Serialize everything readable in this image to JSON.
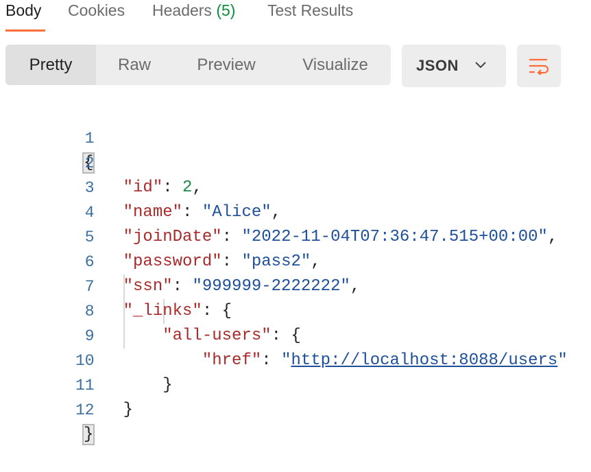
{
  "tabs": [
    {
      "label": "Body"
    },
    {
      "label": "Cookies"
    },
    {
      "label": "Headers",
      "count": "(5)"
    },
    {
      "label": "Test Results"
    }
  ],
  "toolbar": {
    "view_modes": [
      "Pretty",
      "Raw",
      "Preview",
      "Visualize"
    ],
    "active_view": "Pretty",
    "format": "JSON",
    "wrap_icon": "wrap-lines-icon"
  },
  "code": {
    "line_numbers": [
      "1",
      "2",
      "3",
      "4",
      "5",
      "6",
      "7",
      "8",
      "9",
      "10",
      "11",
      "12"
    ],
    "open_brace": "{",
    "close_brace": "}",
    "l2_key": "\"id\"",
    "l2_val": "2",
    "l3_key": "\"name\"",
    "l3_val": "\"Alice\"",
    "l4_key": "\"joinDate\"",
    "l4_val": "\"2022-11-04T07:36:47.515+00:00\"",
    "l5_key": "\"password\"",
    "l5_val": "\"pass2\"",
    "l6_key": "\"ssn\"",
    "l6_val": "\"999999-2222222\"",
    "l7_key": "\"_links\"",
    "l8_key": "\"all-users\"",
    "l9_key": "\"href\"",
    "l9_q": "\"",
    "l9_url": "http://localhost:8088/users"
  },
  "colors": {
    "accent": "#ff6c37",
    "key": "#a82a2a",
    "string": "#1e4f9a",
    "number": "#1d8a4b",
    "line_number": "#3a6fa0"
  }
}
